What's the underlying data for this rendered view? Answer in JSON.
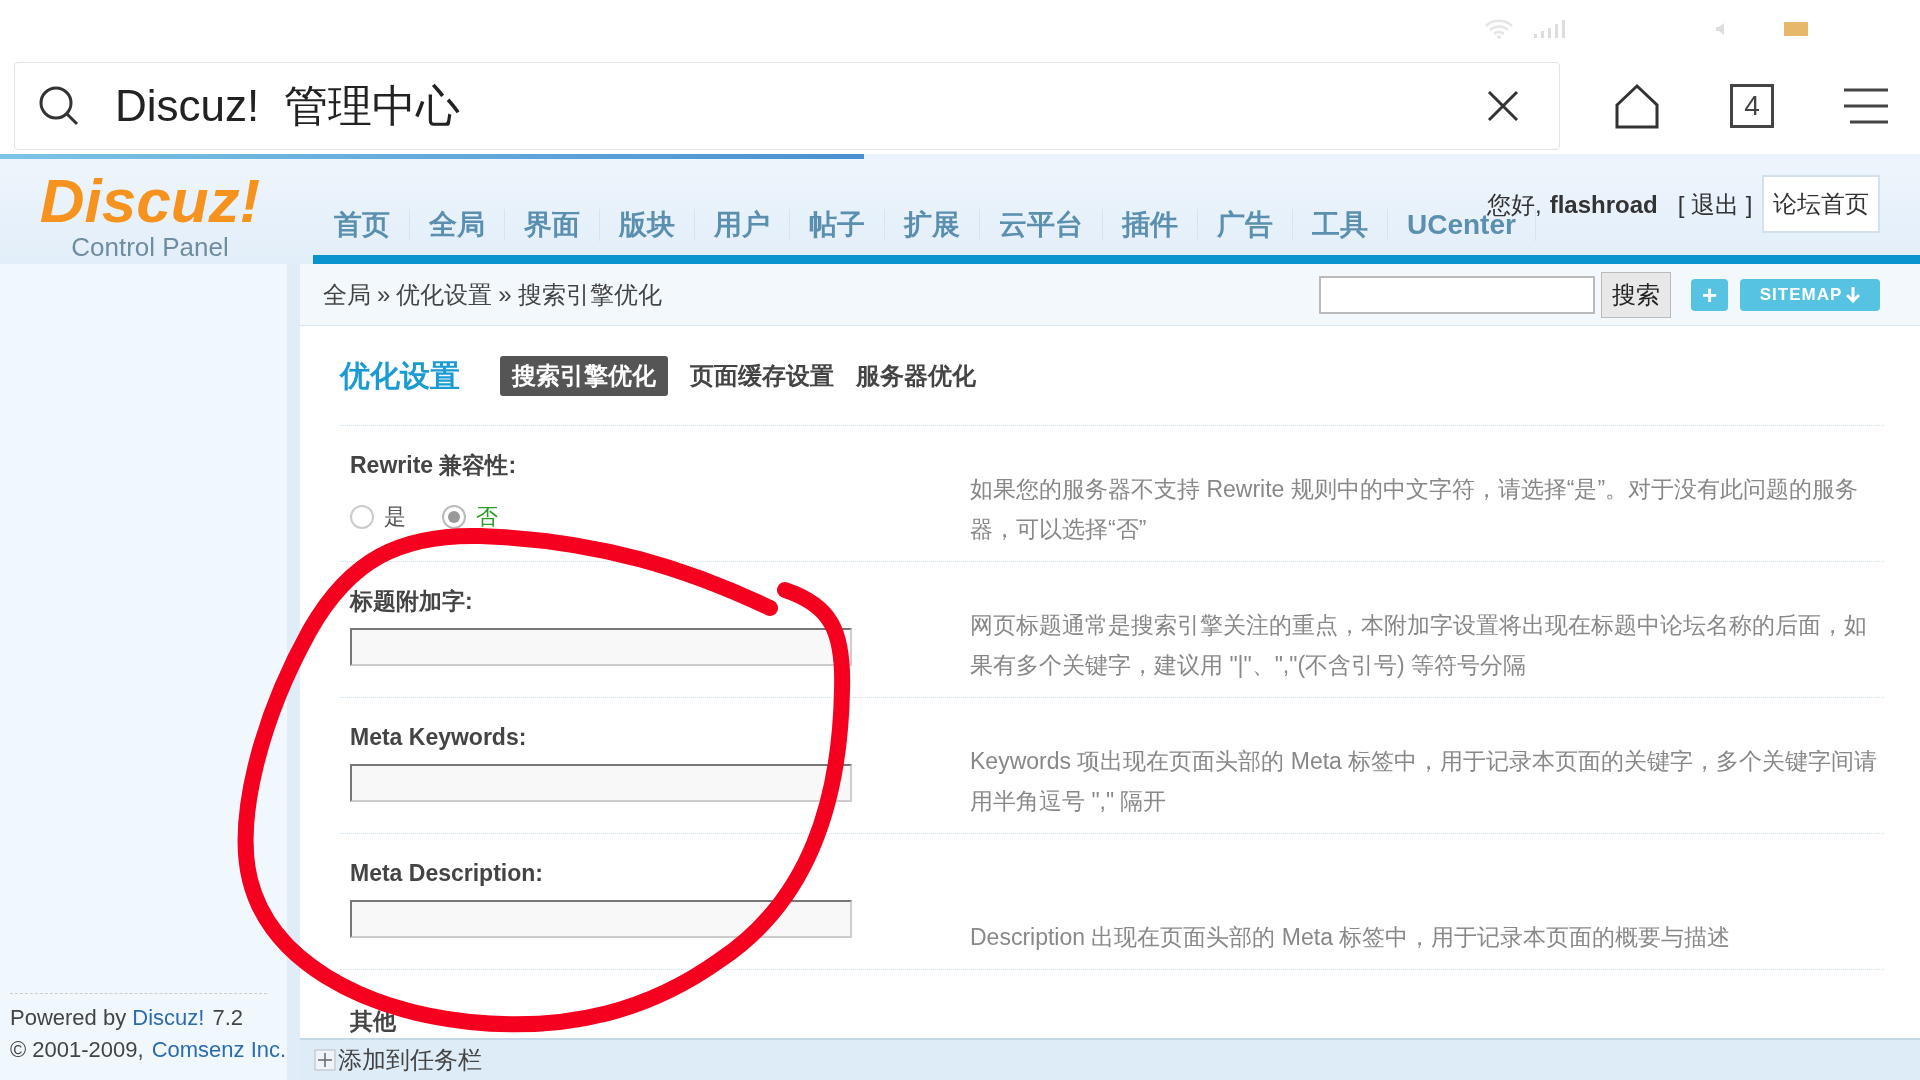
{
  "browser": {
    "address": "Discuz!  管理中心",
    "tab_count": "4",
    "progress": {
      "level": 0.45
    }
  },
  "header": {
    "logo": "Discuz!",
    "logo_subtitle": "Control Panel",
    "nav": [
      "首页",
      "全局",
      "界面",
      "版块",
      "用户",
      "帖子",
      "扩展",
      "云平台",
      "插件",
      "广告",
      "工具",
      "UCenter"
    ],
    "greeting": "您好,",
    "user": "flashroad",
    "logout": "[ 退出 ]",
    "forum_home": "论坛首页"
  },
  "breadcrumb": {
    "items": [
      "全局",
      "优化设置",
      "搜索引擎优化"
    ],
    "separator": "»",
    "search_button": "搜索",
    "add_button": "+",
    "sitemap_button": "SITEMAP"
  },
  "section_title": "优化设置",
  "tabs": [
    {
      "label": "搜索引擎优化",
      "selected": true
    },
    {
      "label": "页面缓存设置",
      "selected": false
    },
    {
      "label": "服务器优化",
      "selected": false
    }
  ],
  "settings": [
    {
      "kind": "radio",
      "label": "Rewrite 兼容性:",
      "options": [
        {
          "label": "是",
          "selected": false
        },
        {
          "label": "否",
          "selected": true
        }
      ],
      "description": "如果您的服务器不支持 Rewrite 规则中的中文字符，请选择“是”。对于没有此问题的服务器，可以选择“否”"
    },
    {
      "kind": "text",
      "label": "标题附加字:",
      "description": "网页标题通常是搜索引擎关注的重点，本附加字设置将出现在标题中论坛名称的后面，如果有多个关键字，建议用 \"|\"、\",\"(不含引号) 等符号分隔"
    },
    {
      "kind": "text",
      "label": "Meta Keywords:",
      "description": "Keywords 项出现在页面头部的 Meta 标签中，用于记录本页面的关键字，多个关键字间请用半角逗号 \",\" 隔开"
    },
    {
      "kind": "text",
      "label": "Meta Description:",
      "description": "Description 出现在页面头部的 Meta 标签中，用于记录本页面的概要与描述"
    },
    {
      "kind": "heading",
      "label": "其他"
    }
  ],
  "footer": {
    "powered": "Powered by",
    "product": "Discuz!",
    "version": "7.2",
    "copyright": "© 2001-2009,",
    "company": "Comsenz Inc."
  },
  "taskbar": {
    "label": "添加到任务栏"
  }
}
